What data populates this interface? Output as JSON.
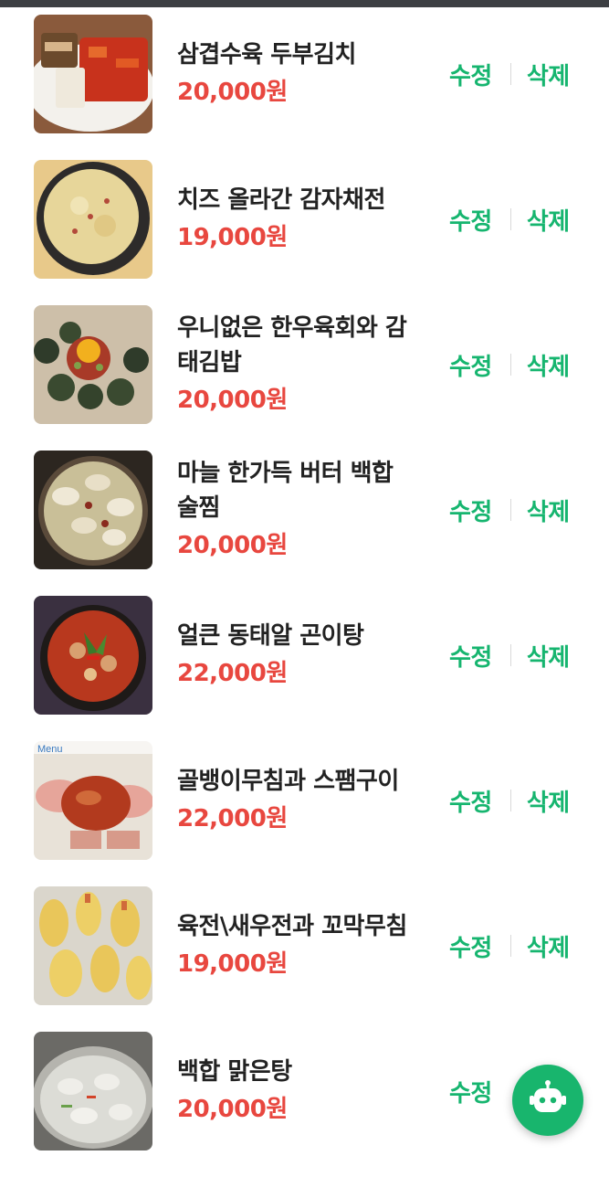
{
  "menu": {
    "items": [
      {
        "name": "삼겹수육 두부김치",
        "price": "20,000원",
        "edit": "수정",
        "delete": "삭제"
      },
      {
        "name": "치즈 올라간 감자채전",
        "price": "19,000원",
        "edit": "수정",
        "delete": "삭제"
      },
      {
        "name": "우니없은 한우육회와 감태김밥",
        "price": "20,000원",
        "edit": "수정",
        "delete": "삭제"
      },
      {
        "name": "마늘 한가득 버터 백합 술찜",
        "price": "20,000원",
        "edit": "수정",
        "delete": "삭제"
      },
      {
        "name": "얼큰 동태알 곤이탕",
        "price": "22,000원",
        "edit": "수정",
        "delete": "삭제"
      },
      {
        "name": "골뱅이무침과 스팸구이",
        "price": "22,000원",
        "edit": "수정",
        "delete": "삭제"
      },
      {
        "name": "육전\\새우전과 꼬막무침",
        "price": "19,000원",
        "edit": "수정",
        "delete": "삭제"
      },
      {
        "name": "백합 맑은탕",
        "price": "20,000원",
        "edit": "수정",
        "delete": ""
      }
    ]
  },
  "thumbnail_watermark": "Menu",
  "chatbot": {
    "icon": "robot-icon"
  },
  "colors": {
    "accent_green": "#16b56f",
    "price_red": "#e8473f",
    "text": "#222222"
  }
}
